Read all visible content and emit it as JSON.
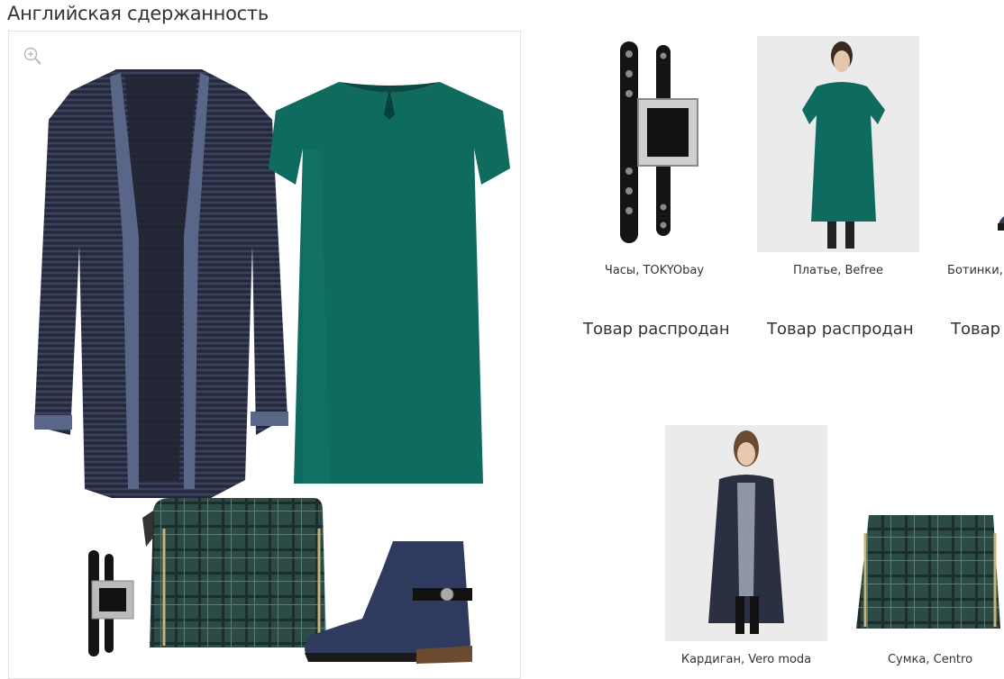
{
  "page_title": "Английская сдержанность",
  "collage": {
    "zoom_icon": "zoom-in-icon",
    "items": [
      "cardigan-image",
      "dress-image",
      "watch-image",
      "bag-image",
      "boots-image"
    ]
  },
  "products": [
    {
      "caption": "Часы, TOKYObay",
      "status": "Товар распродан"
    },
    {
      "caption": "Платье, Befree",
      "status": "Товар распродан"
    },
    {
      "caption": "Ботинки,",
      "status": "Товар"
    },
    {
      "caption": "Кардиган, Vero moda"
    },
    {
      "caption": "Сумка, Centro"
    }
  ],
  "colors": {
    "dress": "#0f6b5e",
    "cardigan": "#2a3042",
    "boots": "#2f3b5e",
    "bag": "#2c4a46"
  }
}
